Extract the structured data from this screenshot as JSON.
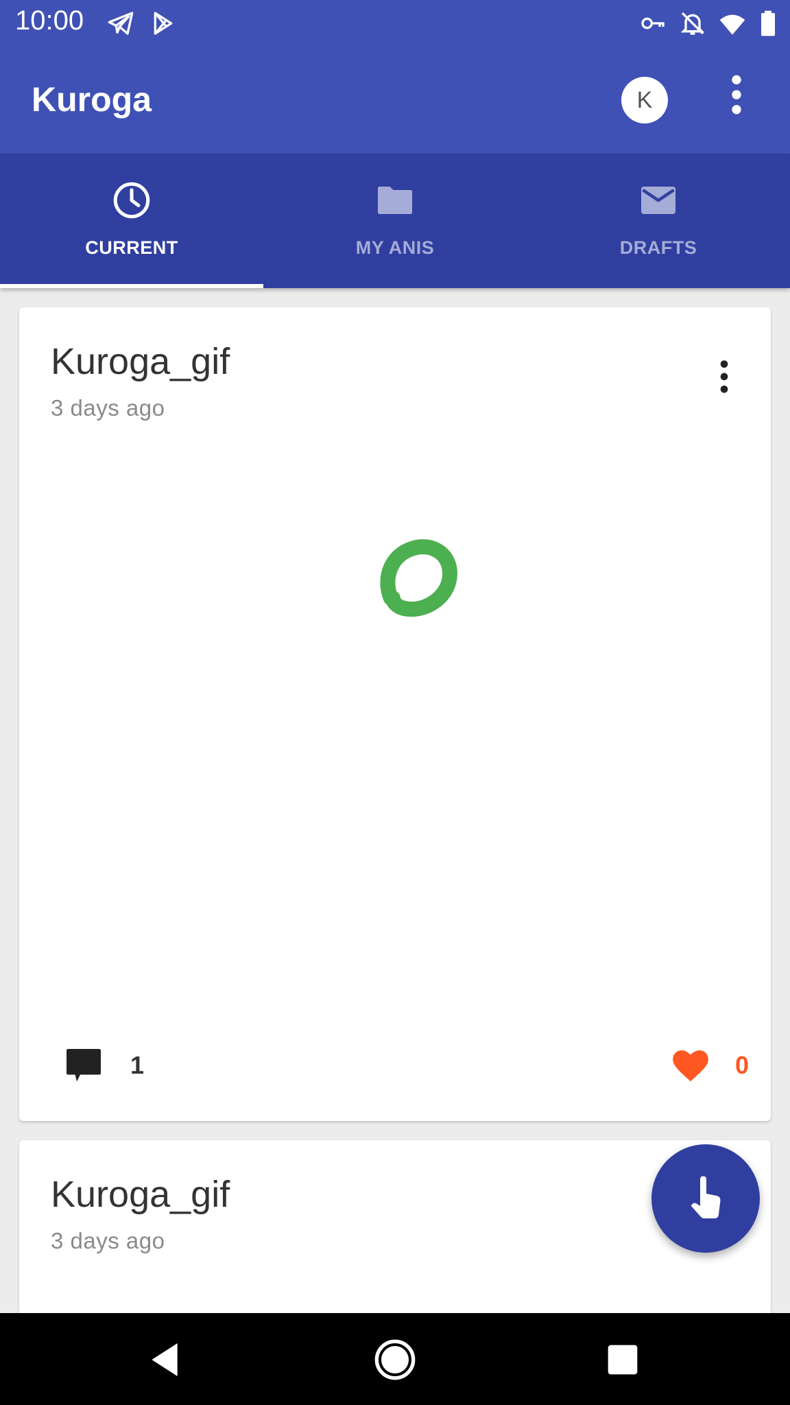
{
  "status_bar": {
    "time": "10:00",
    "left_icons": [
      "telegram-icon",
      "play-store-icon"
    ],
    "right_icons": [
      "vpn-key-icon",
      "notifications-off-icon",
      "wifi-icon",
      "battery-icon"
    ]
  },
  "app_bar": {
    "title": "Kuroga",
    "avatar_letter": "K",
    "overflow_icon": "more-vert-icon"
  },
  "tabs": [
    {
      "label": "CURRENT",
      "icon": "clock-icon",
      "active": true
    },
    {
      "label": "MY ANIS",
      "icon": "folder-icon",
      "active": false
    },
    {
      "label": "DRAFTS",
      "icon": "mail-icon",
      "active": false
    }
  ],
  "posts": [
    {
      "title": "Kuroga_gif",
      "time": "3 days ago",
      "comments": "1",
      "likes": "0"
    },
    {
      "title": "Kuroga_gif",
      "time": "3 days ago"
    }
  ],
  "fab": {
    "icon": "touch-hand-icon"
  },
  "colors": {
    "primary": "#3f51b5",
    "primary_dark": "#303f9f",
    "accent_like": "#ff5722",
    "drawing": "#4caf50"
  }
}
